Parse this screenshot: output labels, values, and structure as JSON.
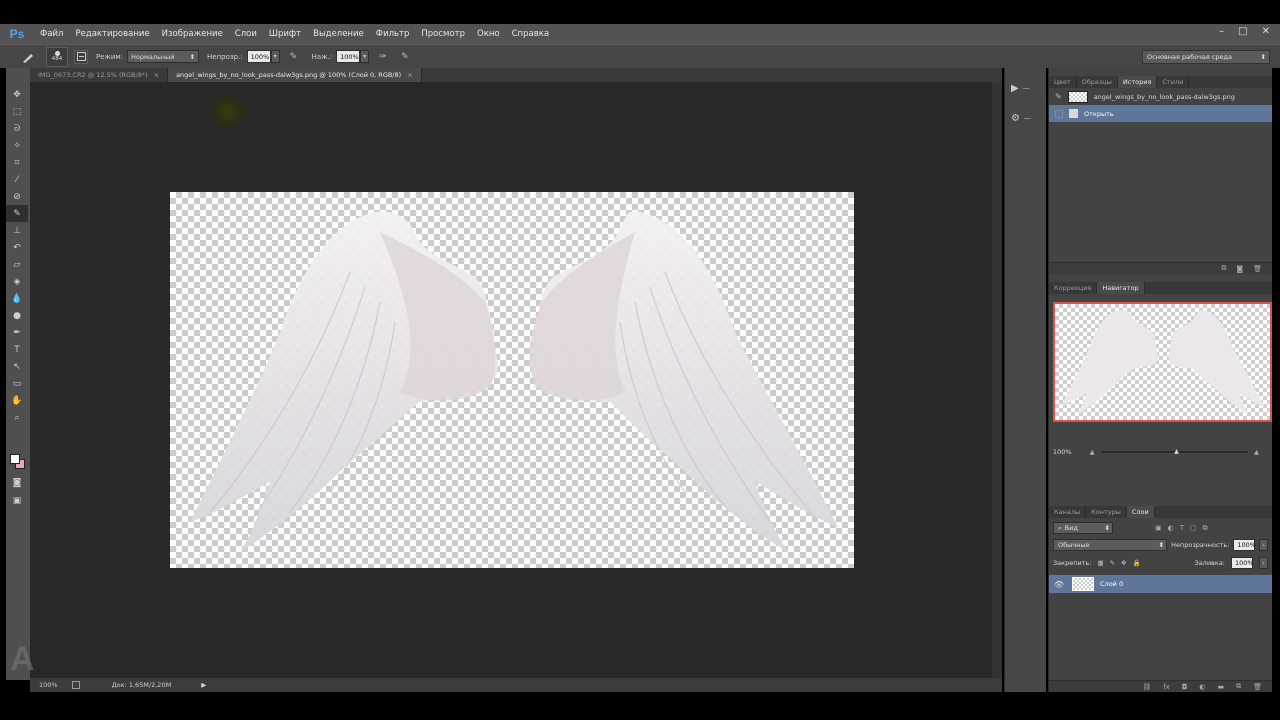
{
  "app": {
    "logo": "Ps"
  },
  "menu": [
    "Файл",
    "Редактирование",
    "Изображение",
    "Слои",
    "Шрифт",
    "Выделение",
    "Фильтр",
    "Просмотр",
    "Окно",
    "Справка"
  ],
  "window_controls": [
    "–",
    "□",
    "✕"
  ],
  "options": {
    "brush_size": "484",
    "mode_label": "Режим:",
    "mode_value": "Нормальный",
    "opacity_label": "Непрозр.:",
    "opacity_value": "100%",
    "flow_label": "Наж.:",
    "flow_value": "100%",
    "workspace": "Основная рабочая среда"
  },
  "doc_tabs": [
    {
      "label": "IMG_0673.CR2 @ 12,5% (RGB/8*)",
      "close": "×"
    },
    {
      "label": "angel_wings_by_no_look_pass-daiw3gs.png @ 100% (Слой 0, RGB/8)",
      "close": "×"
    }
  ],
  "status": {
    "zoom": "100%",
    "doc_info": "Док: 1,65M/2,20M"
  },
  "history_panel": {
    "tabs": [
      "Цвет",
      "Образцы",
      "История",
      "Стили"
    ],
    "snapshot": "angel_wings_by_no_look_pass-daiw3gs.png",
    "step": "Открыть"
  },
  "navigator_panel": {
    "tabs": [
      "Коррекция",
      "Навигатор"
    ],
    "zoom": "100%"
  },
  "layers_panel": {
    "tabs": [
      "Каналы",
      "Контуры",
      "Слои"
    ],
    "filter": "Вид",
    "blend_mode": "Обычные",
    "opacity_label": "Непрозрачность:",
    "opacity_value": "100%",
    "lock_label": "Закрепить:",
    "fill_label": "Заливка:",
    "fill_value": "100%",
    "layer_name": "Слой 0"
  },
  "watermark": "A"
}
